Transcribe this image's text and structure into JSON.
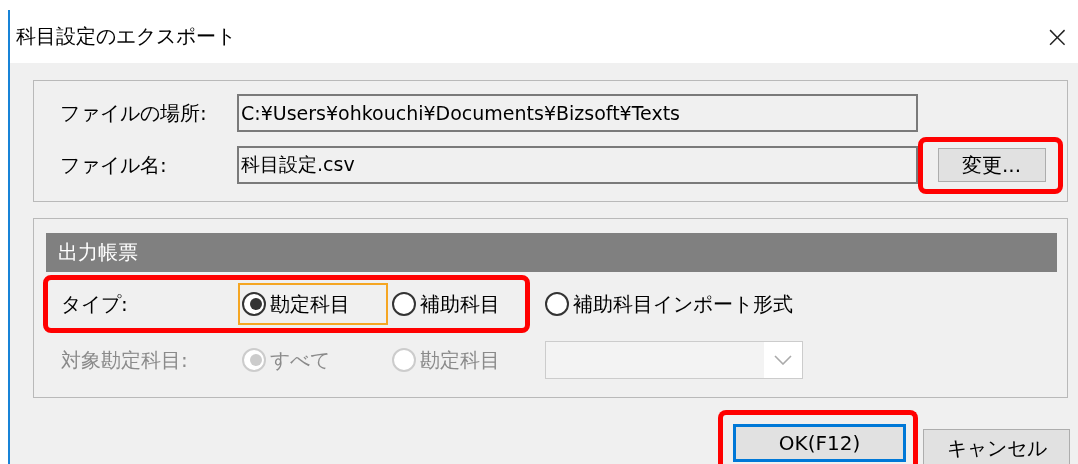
{
  "window": {
    "title": "科目設定のエクスポート",
    "close": "×"
  },
  "file": {
    "location_label": "ファイルの場所:",
    "location_value": "C:¥Users¥ohkouchi¥Documents¥Bizsoft¥Texts",
    "name_label": "ファイル名:",
    "name_value": "科目設定.csv",
    "change_button": {
      "label": "変更...",
      "highlighted": true
    }
  },
  "output": {
    "header": "出力帳票",
    "type": {
      "label": "タイプ:",
      "options": [
        {
          "label": "勘定科目",
          "selected": true,
          "focused": true,
          "highlighted": true
        },
        {
          "label": "補助科目",
          "selected": false,
          "focused": false,
          "highlighted": true
        },
        {
          "label": "補助科目インポート形式",
          "selected": false,
          "focused": false,
          "highlighted": false
        }
      ]
    },
    "target": {
      "label": "対象勘定科目:",
      "disabled": true,
      "options": [
        {
          "label": "すべて",
          "selected": true
        },
        {
          "label": "勘定科目",
          "selected": false
        }
      ],
      "combo": {
        "disabled": true
      }
    }
  },
  "buttons": [
    {
      "label": "OK(F12)",
      "default": true,
      "highlighted": true
    },
    {
      "label": "キャンセル",
      "default": false,
      "highlighted": false
    }
  ]
}
